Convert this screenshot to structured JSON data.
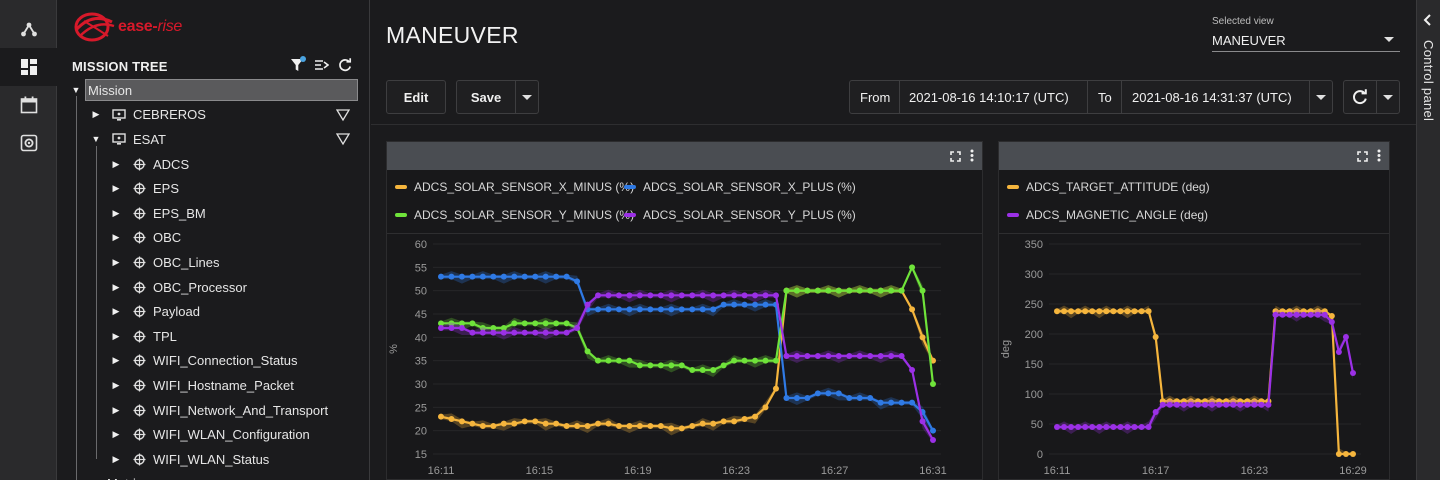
{
  "brand": {
    "logo_prefix": "ease",
    "logo_suffix": "rise",
    "color": "#d7192a"
  },
  "rail": {
    "items": [
      "network-icon",
      "dashboard-icon",
      "calendar-icon",
      "settings-icon"
    ],
    "active": 1
  },
  "sidebar": {
    "title": "MISSION TREE",
    "tools": [
      "filter-icon",
      "collapse-list-icon",
      "refresh-icon"
    ],
    "tree": [
      {
        "label": "Mission",
        "depth": 0,
        "expanded": true,
        "selected": true,
        "icon": ""
      },
      {
        "label": "CEBREROS",
        "depth": 1,
        "expanded": false,
        "icon": "station-icon",
        "filter": true
      },
      {
        "label": "ESAT",
        "depth": 1,
        "expanded": true,
        "icon": "station-icon",
        "filter": true
      },
      {
        "label": "ADCS",
        "depth": 2,
        "expanded": false,
        "icon": "component-icon"
      },
      {
        "label": "EPS",
        "depth": 2,
        "expanded": false,
        "icon": "component-icon"
      },
      {
        "label": "EPS_BM",
        "depth": 2,
        "expanded": false,
        "icon": "component-icon"
      },
      {
        "label": "OBC",
        "depth": 2,
        "expanded": false,
        "icon": "component-icon"
      },
      {
        "label": "OBC_Lines",
        "depth": 2,
        "expanded": false,
        "icon": "component-icon"
      },
      {
        "label": "OBC_Processor",
        "depth": 2,
        "expanded": false,
        "icon": "component-icon"
      },
      {
        "label": "Payload",
        "depth": 2,
        "expanded": false,
        "icon": "component-icon"
      },
      {
        "label": "TPL",
        "depth": 2,
        "expanded": false,
        "icon": "component-icon"
      },
      {
        "label": "WIFI_Connection_Status",
        "depth": 2,
        "expanded": false,
        "icon": "component-icon"
      },
      {
        "label": "WIFI_Hostname_Packet",
        "depth": 2,
        "expanded": false,
        "icon": "component-icon"
      },
      {
        "label": "WIFI_Network_And_Transport",
        "depth": 2,
        "expanded": false,
        "icon": "component-icon"
      },
      {
        "label": "WIFI_WLAN_Configuration",
        "depth": 2,
        "expanded": false,
        "icon": "component-icon"
      },
      {
        "label": "WIFI_WLAN_Status",
        "depth": 2,
        "expanded": false,
        "icon": "component-icon"
      },
      {
        "label": "Metrics",
        "depth": 1,
        "expanded": false,
        "icon": ""
      }
    ]
  },
  "header": {
    "title": "MANEUVER",
    "view_label": "Selected view",
    "view_value": "MANEUVER",
    "edit_label": "Edit",
    "save_label": "Save",
    "from_label": "From",
    "from_value": "2021-08-16 14:10:17 (UTC)",
    "to_label": "To",
    "to_value": "2021-08-16 14:31:37 (UTC)"
  },
  "control_panel": {
    "label": "Control panel"
  },
  "colors": {
    "orange": "#f5b53d",
    "blue": "#2f7ae5",
    "green": "#6fe33a",
    "purple": "#9b30e6"
  },
  "chart_data": [
    {
      "type": "line",
      "ylabel": "%",
      "ylim": [
        15,
        60
      ],
      "yticks": [
        15,
        20,
        25,
        30,
        35,
        40,
        45,
        50,
        55,
        60
      ],
      "xticks": [
        "16:11",
        "16:15",
        "16:19",
        "16:23",
        "16:27",
        "16:31"
      ],
      "series": [
        {
          "name": "ADCS_SOLAR_SENSOR_X_MINUS (%)",
          "color": "#f5b53d",
          "values": [
            23,
            22.5,
            22,
            21.5,
            21,
            21,
            21.5,
            21.5,
            22,
            22,
            21.5,
            21.5,
            21,
            21,
            21,
            21.5,
            21.5,
            21,
            21,
            21,
            21,
            21,
            20.5,
            20.5,
            21,
            21.5,
            21.5,
            22,
            22,
            22.5,
            23,
            25,
            29,
            50,
            50,
            50,
            50,
            50,
            50,
            50,
            50,
            50,
            50,
            50,
            50,
            46,
            40,
            35
          ]
        },
        {
          "name": "ADCS_SOLAR_SENSOR_X_PLUS (%)",
          "color": "#2f7ae5",
          "values": [
            53,
            53,
            53,
            53,
            53,
            53,
            53,
            53,
            53,
            53,
            53,
            53,
            53,
            52,
            46,
            46,
            46,
            46,
            46,
            46,
            46,
            46,
            46,
            46,
            46,
            46,
            46,
            47,
            47,
            47,
            47,
            47,
            47,
            27,
            27,
            27,
            28,
            28,
            28,
            27,
            27,
            27,
            26,
            26,
            26,
            26,
            24,
            20
          ]
        },
        {
          "name": "ADCS_SOLAR_SENSOR_Y_MINUS (%)",
          "color": "#6fe33a",
          "values": [
            43,
            43,
            43,
            43,
            42,
            42,
            42,
            43,
            43,
            43,
            43,
            43,
            43,
            42,
            37,
            35,
            35,
            35,
            35,
            34,
            34,
            34,
            34,
            34,
            33,
            33,
            33,
            34,
            35,
            35,
            35,
            35,
            35,
            50,
            50,
            50,
            50,
            50,
            50,
            50,
            50,
            50,
            50,
            50,
            50,
            55,
            50,
            30
          ]
        },
        {
          "name": "ADCS_SOLAR_SENSOR_Y_PLUS (%)",
          "color": "#9b30e6",
          "values": [
            42,
            42,
            42,
            41,
            41,
            41,
            41,
            41,
            41,
            41,
            41,
            41,
            41,
            42,
            47,
            49,
            49,
            49,
            49,
            49,
            49,
            49,
            49,
            49,
            49,
            49,
            49,
            49,
            49,
            49,
            49,
            49,
            49,
            36,
            36,
            36,
            36,
            36,
            36,
            36,
            36,
            36,
            36,
            36,
            36,
            33,
            22,
            18
          ]
        }
      ]
    },
    {
      "type": "line",
      "ylabel": "deg",
      "ylim": [
        0,
        350
      ],
      "yticks": [
        0,
        50,
        100,
        150,
        200,
        250,
        300,
        350
      ],
      "xticks": [
        "16:11",
        "16:17",
        "16:23",
        "16:29"
      ],
      "series": [
        {
          "name": "ADCS_TARGET_ATTITUDE (deg)",
          "color": "#f5b53d",
          "values": [
            238,
            238,
            238,
            238,
            238,
            238,
            238,
            238,
            238,
            238,
            238,
            238,
            238,
            238,
            195,
            88,
            88,
            88,
            88,
            88,
            88,
            88,
            88,
            88,
            88,
            88,
            88,
            88,
            88,
            88,
            88,
            238,
            238,
            238,
            238,
            238,
            238,
            238,
            238,
            230,
            0,
            0,
            0
          ]
        },
        {
          "name": "ADCS_MAGNETIC_ANGLE (deg)",
          "color": "#9b30e6",
          "values": [
            45,
            45,
            45,
            45,
            45,
            45,
            45,
            45,
            45,
            45,
            45,
            45,
            45,
            45,
            70,
            82,
            82,
            82,
            82,
            82,
            82,
            82,
            82,
            82,
            82,
            82,
            82,
            82,
            82,
            82,
            82,
            232,
            232,
            232,
            232,
            232,
            232,
            232,
            232,
            220,
            170,
            195,
            135
          ]
        }
      ]
    }
  ]
}
